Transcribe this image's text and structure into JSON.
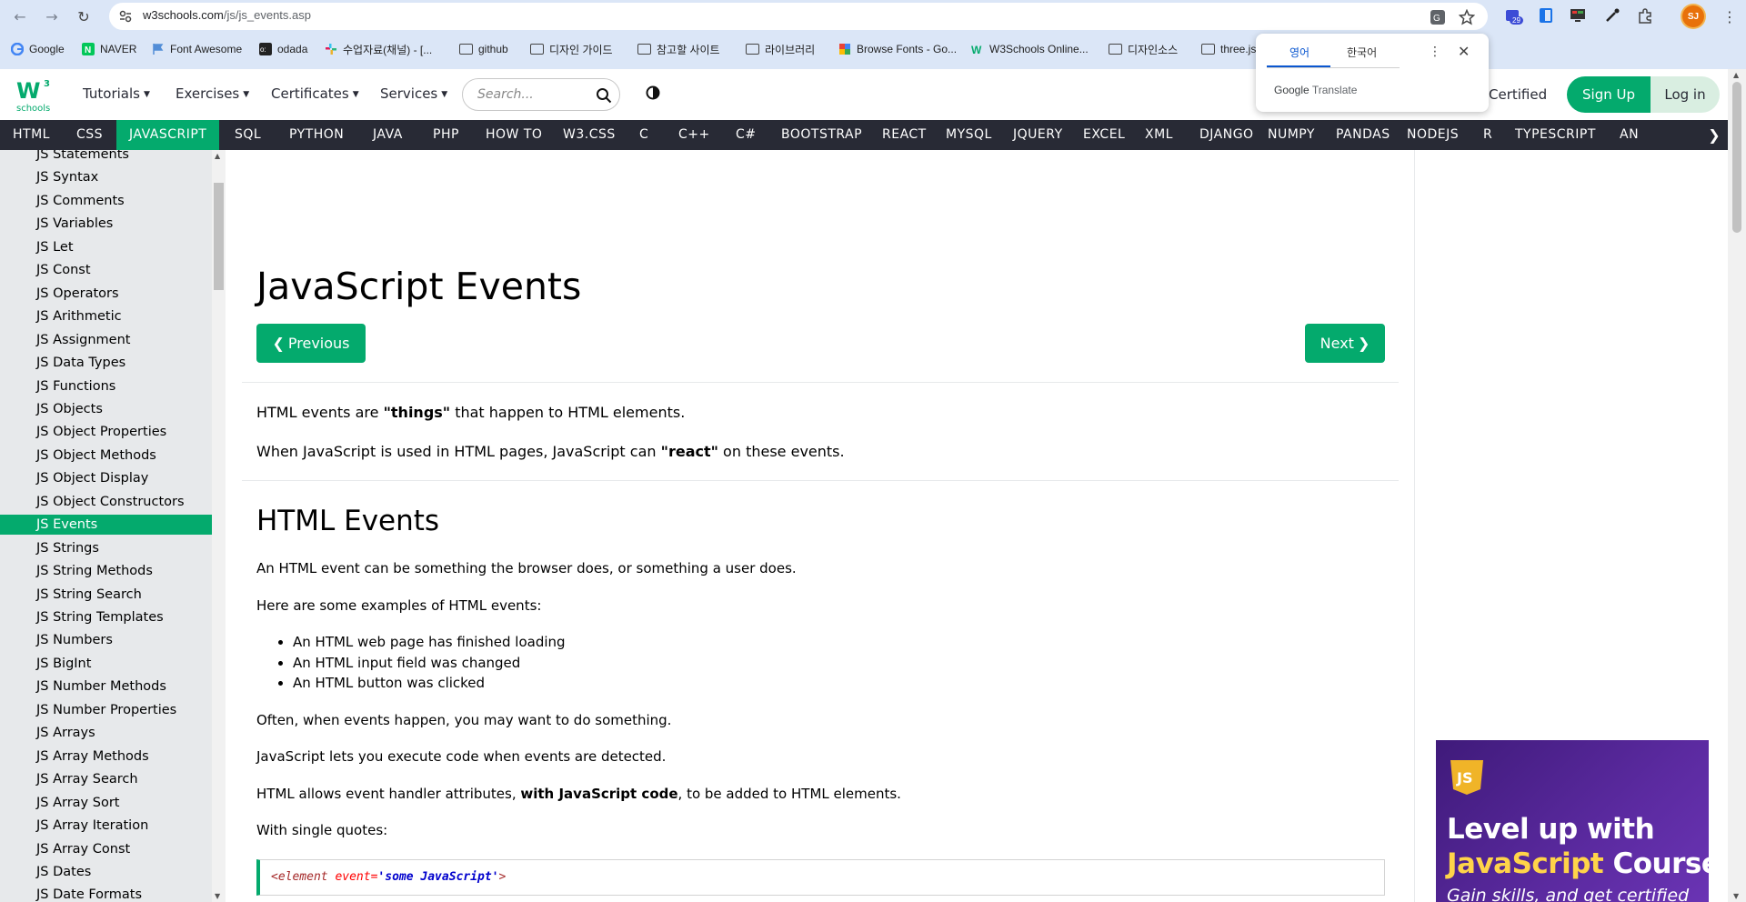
{
  "browser": {
    "url_host": "w3schools.com",
    "url_path": "/js/js_events.asp",
    "profile_initials": "SJ",
    "extension_badge": "29",
    "bookmarks": [
      {
        "label": "Google",
        "icon": "google-icon"
      },
      {
        "label": "NAVER",
        "icon": "naver-icon"
      },
      {
        "label": "Font Awesome",
        "icon": "flag-icon"
      },
      {
        "label": "odada",
        "icon": "odada-icon"
      },
      {
        "label": "수업자료(채널) - [...",
        "icon": "slack-icon"
      },
      {
        "label": "github",
        "icon": "folder-icon"
      },
      {
        "label": "디자인 가이드",
        "icon": "folder-icon"
      },
      {
        "label": "참고할 사이트",
        "icon": "folder-icon"
      },
      {
        "label": "라이브러리",
        "icon": "folder-icon"
      },
      {
        "label": "Browse Fonts - Go...",
        "icon": "google-fonts-icon"
      },
      {
        "label": "W3Schools Online...",
        "icon": "w3schools-icon"
      },
      {
        "label": "디자인소스",
        "icon": "folder-icon"
      },
      {
        "label": "three.js",
        "icon": "folder-icon"
      }
    ]
  },
  "translate_popup": {
    "lang_source": "영어",
    "lang_target": "한국어",
    "brand_google": "Google",
    "brand_translate": "Translate"
  },
  "topnav": {
    "tutorials": "Tutorials",
    "exercises": "Exercises",
    "certificates": "Certificates",
    "services": "Services",
    "search_placeholder": "Search...",
    "certified": "Certified",
    "signup": "Sign Up",
    "login": "Log in"
  },
  "subjects": [
    "HTML",
    "CSS",
    "JAVASCRIPT",
    "SQL",
    "PYTHON",
    "JAVA",
    "PHP",
    "HOW TO",
    "W3.CSS",
    "C",
    "C++",
    "C#",
    "BOOTSTRAP",
    "REACT",
    "MYSQL",
    "JQUERY",
    "EXCEL",
    "XML",
    "DJANGO",
    "NUMPY",
    "PANDAS",
    "NODEJS",
    "R",
    "TYPESCRIPT",
    "AN"
  ],
  "active_subject": "JAVASCRIPT",
  "sidebar": {
    "items": [
      "JS Statements",
      "JS Syntax",
      "JS Comments",
      "JS Variables",
      "JS Let",
      "JS Const",
      "JS Operators",
      "JS Arithmetic",
      "JS Assignment",
      "JS Data Types",
      "JS Functions",
      "JS Objects",
      "JS Object Properties",
      "JS Object Methods",
      "JS Object Display",
      "JS Object Constructors",
      "JS Events",
      "JS Strings",
      "JS String Methods",
      "JS String Search",
      "JS String Templates",
      "JS Numbers",
      "JS BigInt",
      "JS Number Methods",
      "JS Number Properties",
      "JS Arrays",
      "JS Array Methods",
      "JS Array Search",
      "JS Array Sort",
      "JS Array Iteration",
      "JS Array Const",
      "JS Dates",
      "JS Date Formats"
    ],
    "active": "JS Events"
  },
  "main": {
    "title": "JavaScript Events",
    "prev": "Previous",
    "next": "Next",
    "intro1_a": "HTML events are ",
    "intro1_b": "\"things\"",
    "intro1_c": " that happen to HTML elements.",
    "intro2_a": "When JavaScript is used in HTML pages, JavaScript can ",
    "intro2_b": "\"react\"",
    "intro2_c": " on these events.",
    "h2": "HTML Events",
    "p1": "An HTML event can be something the browser does, or something a user does.",
    "p2": "Here are some examples of HTML events:",
    "bullets": [
      "An HTML web page has finished loading",
      "An HTML input field was changed",
      "An HTML button was clicked"
    ],
    "p3": "Often, when events happen, you may want to do something.",
    "p4": "JavaScript lets you execute code when events are detected.",
    "p5_a": "HTML allows event handler attributes, ",
    "p5_b": "with JavaScript code",
    "p5_c": ", to be added to HTML elements.",
    "p6": "With single quotes:",
    "code_open": "<",
    "code_tag": "element",
    "code_attr": "event",
    "code_eq": "=",
    "code_val": "'some JavaScript'",
    "code_close": ">"
  },
  "ad": {
    "line1": "Level up with",
    "line2_hl": "JavaScript",
    "line2_rest": " Course",
    "line3": "Gain skills, and get certified"
  },
  "colors": {
    "brand_green": "#04aa6d",
    "subject_bar": "#282a35",
    "sidebar_bg": "#e7e9eb"
  }
}
